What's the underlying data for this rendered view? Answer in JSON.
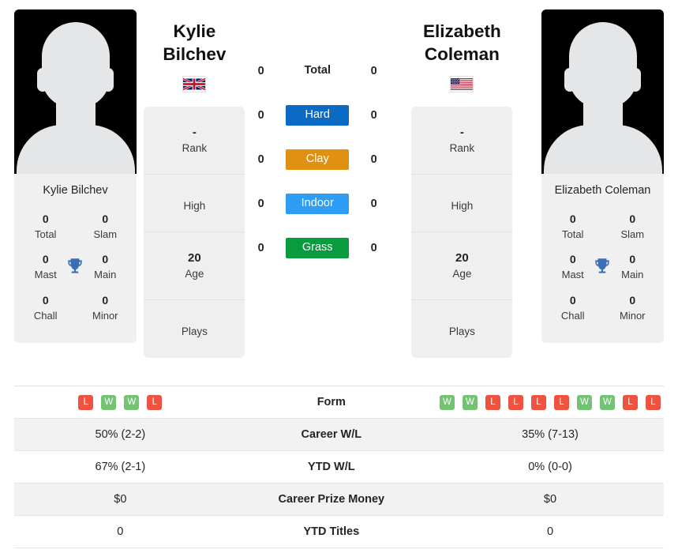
{
  "players": {
    "left": {
      "name": "Kylie Bilchev",
      "photo_caption": "Kylie Bilchev",
      "flag": "gb-flag-icon",
      "flag_alt": "United Kingdom",
      "honours": [
        {
          "value": "0",
          "label": "Total"
        },
        {
          "value": "0",
          "label": "Slam"
        },
        {
          "value": "0",
          "label": "Mast"
        },
        {
          "value": "0",
          "label": "Main"
        },
        {
          "value": "0",
          "label": "Chall"
        },
        {
          "value": "0",
          "label": "Minor"
        }
      ],
      "details": [
        {
          "value": "-",
          "label": "Rank"
        },
        {
          "value": "",
          "label": "High"
        },
        {
          "value": "20",
          "label": "Age"
        },
        {
          "value": "",
          "label": "Plays"
        }
      ],
      "surface_counts": {
        "Total": "0",
        "Hard": "0",
        "Clay": "0",
        "Indoor": "0",
        "Grass": "0"
      },
      "form": [
        "L",
        "W",
        "W",
        "L"
      ],
      "career_wl": "50% (2-2)",
      "ytd_wl": "67% (2-1)",
      "career_prize_money": "$0",
      "ytd_titles": "0"
    },
    "right": {
      "name": "Elizabeth Coleman",
      "photo_caption": "Elizabeth Coleman",
      "flag": "us-flag-icon",
      "flag_alt": "United States",
      "honours": [
        {
          "value": "0",
          "label": "Total"
        },
        {
          "value": "0",
          "label": "Slam"
        },
        {
          "value": "0",
          "label": "Mast"
        },
        {
          "value": "0",
          "label": "Main"
        },
        {
          "value": "0",
          "label": "Chall"
        },
        {
          "value": "0",
          "label": "Minor"
        }
      ],
      "details": [
        {
          "value": "-",
          "label": "Rank"
        },
        {
          "value": "",
          "label": "High"
        },
        {
          "value": "20",
          "label": "Age"
        },
        {
          "value": "",
          "label": "Plays"
        }
      ],
      "surface_counts": {
        "Total": "0",
        "Hard": "0",
        "Clay": "0",
        "Indoor": "0",
        "Grass": "0"
      },
      "form": [
        "W",
        "W",
        "L",
        "L",
        "L",
        "L",
        "W",
        "W",
        "L",
        "L"
      ],
      "career_wl": "35% (7-13)",
      "ytd_wl": "0% (0-0)",
      "career_prize_money": "$0",
      "ytd_titles": "0"
    }
  },
  "surfaces": [
    {
      "label": "Total",
      "style": "plain"
    },
    {
      "label": "Hard",
      "style": "badge",
      "color": "#0b6bc4"
    },
    {
      "label": "Clay",
      "style": "badge",
      "color": "#e09112"
    },
    {
      "label": "Indoor",
      "style": "badge",
      "color": "#2f9df4"
    },
    {
      "label": "Grass",
      "style": "badge",
      "color": "#0a9b3e"
    }
  ],
  "stats_rows": [
    {
      "label": "Form",
      "type": "form"
    },
    {
      "label": "Career W/L",
      "type": "text",
      "key": "career_wl"
    },
    {
      "label": "YTD W/L",
      "type": "text",
      "key": "ytd_wl"
    },
    {
      "label": "Career Prize Money",
      "type": "text",
      "key": "career_prize_money"
    },
    {
      "label": "YTD Titles",
      "type": "text",
      "key": "ytd_titles"
    }
  ],
  "colors": {
    "win_badge": "#74c274",
    "loss_badge": "#ef5340",
    "card_bg": "#f0f0f0",
    "trophy": "#3b6fb5",
    "stripe": "#f2f2f2"
  },
  "icons": {
    "trophy": "trophy-icon"
  }
}
